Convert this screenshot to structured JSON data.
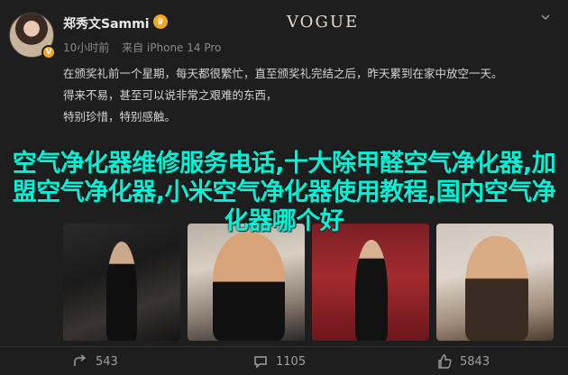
{
  "post": {
    "username": "郑秀文Sammi",
    "time": "10小时前",
    "device": "来自 iPhone 14 Pro",
    "avatar_badge": "V",
    "paragraphs": [
      "在颁奖礼前一个星期，每天都很繁忙，直至颁奖礼完结之后，昨天累到在家中放空一天。",
      "得来不易，甚至可以说非常之艰难的东西，",
      "特别珍惜，特别感触。"
    ],
    "overlay_headline": "空气净化器维修服务电话,十大除甲醛空气净化器,加盟空气净化器,小米空气净化器使用教程,国内空气净化器哪个好",
    "photo_text": "VOGUE"
  },
  "actions": {
    "share_count": "543",
    "comment_count": "1105",
    "like_count": "5843"
  },
  "colors": {
    "background": "#1e1e1e",
    "overlay_text": "#00f2d7",
    "badge": "#f5a623"
  },
  "icons": [
    "crown-icon",
    "chevron-down-icon",
    "share-icon",
    "comment-icon",
    "like-icon"
  ]
}
